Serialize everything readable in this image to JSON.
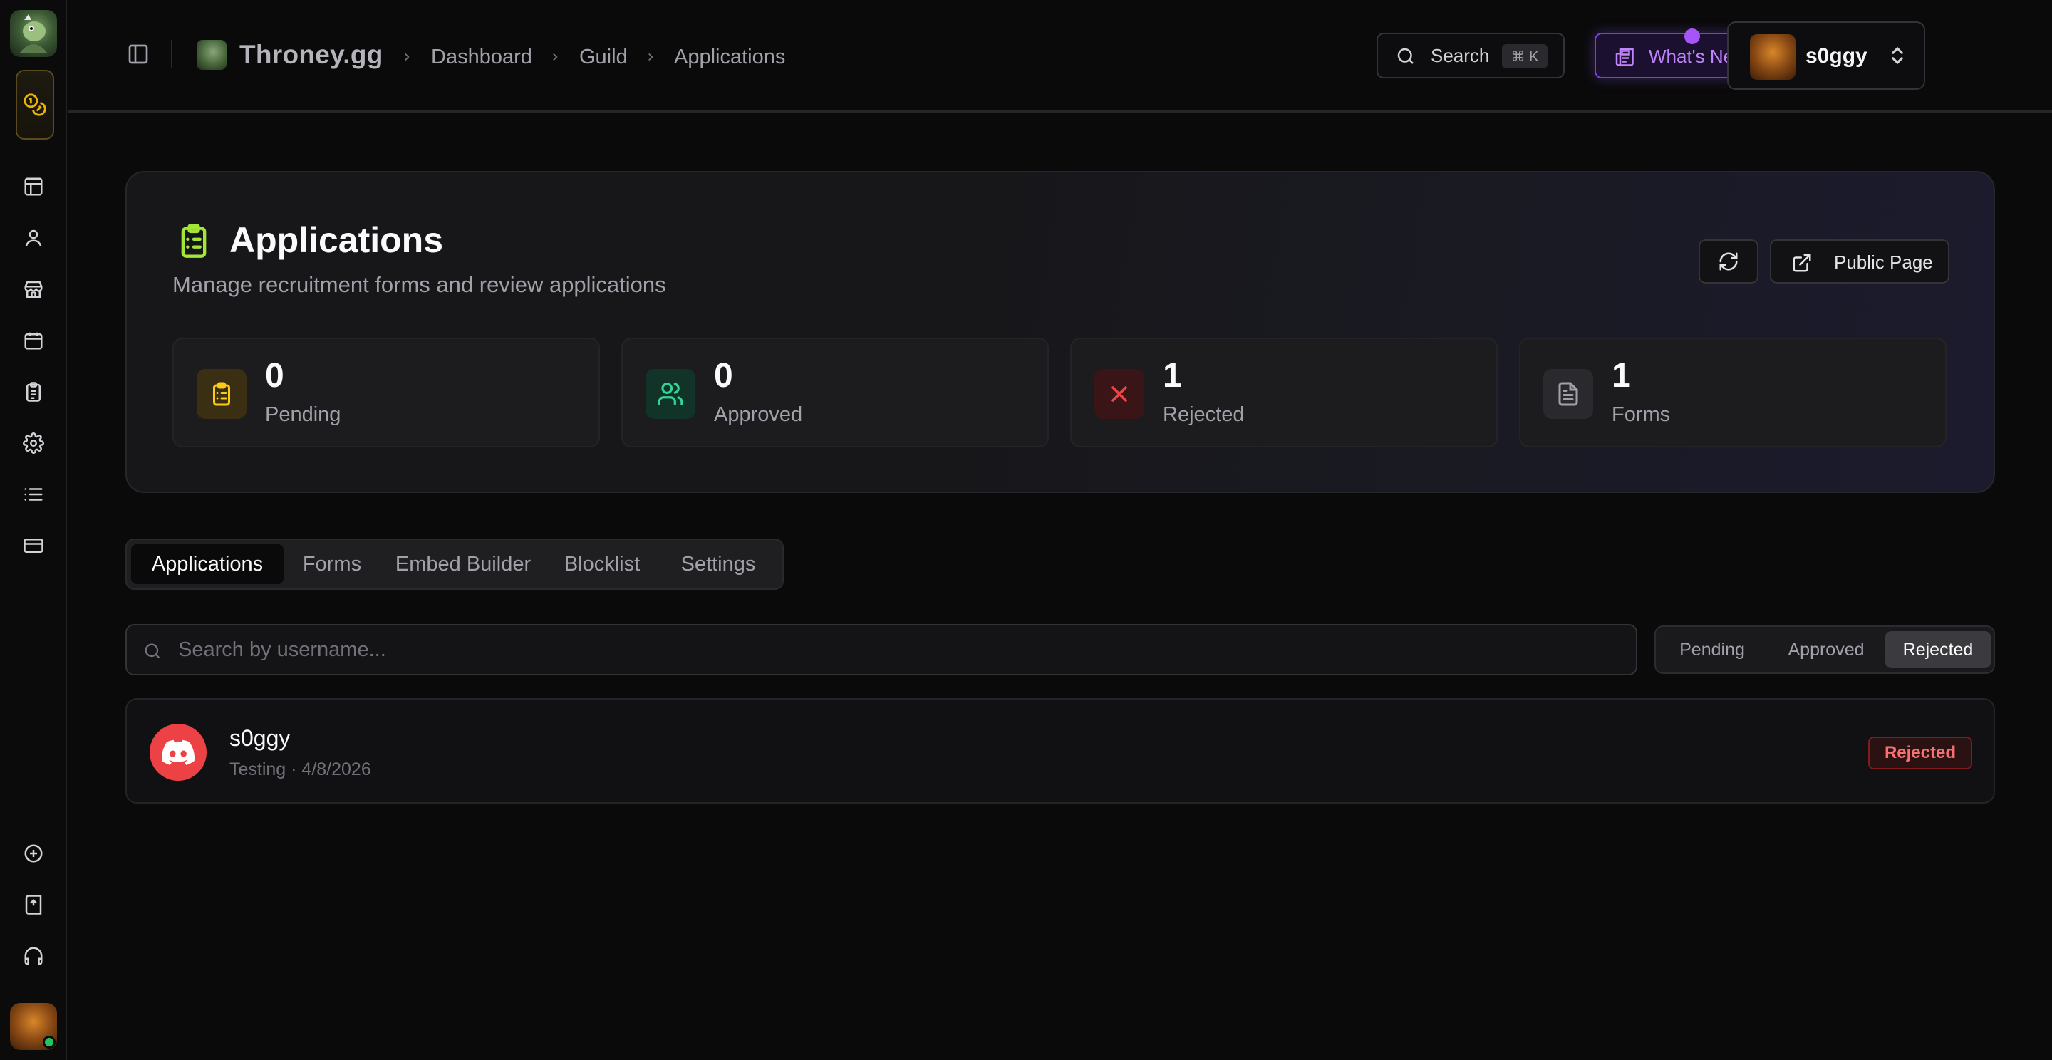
{
  "sidebar": {
    "items": [
      {
        "icon": "layout-icon"
      },
      {
        "icon": "user-icon"
      },
      {
        "icon": "store-icon"
      },
      {
        "icon": "calendar-icon"
      },
      {
        "icon": "clipboard-list-icon"
      },
      {
        "icon": "gear-icon"
      },
      {
        "icon": "list-icon"
      },
      {
        "icon": "credit-card-icon"
      }
    ],
    "bottom_items": [
      {
        "icon": "plus-circle-icon"
      },
      {
        "icon": "book-upload-icon"
      },
      {
        "icon": "headphones-icon"
      }
    ]
  },
  "header": {
    "brand": "Throney.gg",
    "breadcrumbs": [
      "Dashboard",
      "Guild",
      "Applications"
    ],
    "search_label": "Search",
    "search_shortcut": "⌘ K",
    "whats_new_label": "What's New",
    "user_name": "s0ggy"
  },
  "main": {
    "title": "Applications",
    "subtitle": "Manage recruitment forms and review applications",
    "public_page_label": "Public Page",
    "stats": [
      {
        "value": "0",
        "label": "Pending",
        "color": "#facc15"
      },
      {
        "value": "0",
        "label": "Approved",
        "color": "#34d399"
      },
      {
        "value": "1",
        "label": "Rejected",
        "color": "#ef4444"
      },
      {
        "value": "1",
        "label": "Forms",
        "color": "#a1a1aa"
      }
    ],
    "tabs": [
      "Applications",
      "Forms",
      "Embed Builder",
      "Blocklist",
      "Settings"
    ],
    "active_tab": "Applications",
    "search_placeholder": "Search by username...",
    "filters": [
      "Pending",
      "Approved",
      "Rejected"
    ],
    "active_filter": "Rejected",
    "applications": [
      {
        "username": "s0ggy",
        "meta": "Testing · 4/8/2026",
        "status": "Rejected"
      }
    ]
  },
  "colors": {
    "accent_purple": "#a855f7",
    "accent_yellow": "#eab308",
    "reject_red": "#ef4444",
    "discord": "#ed4245"
  }
}
